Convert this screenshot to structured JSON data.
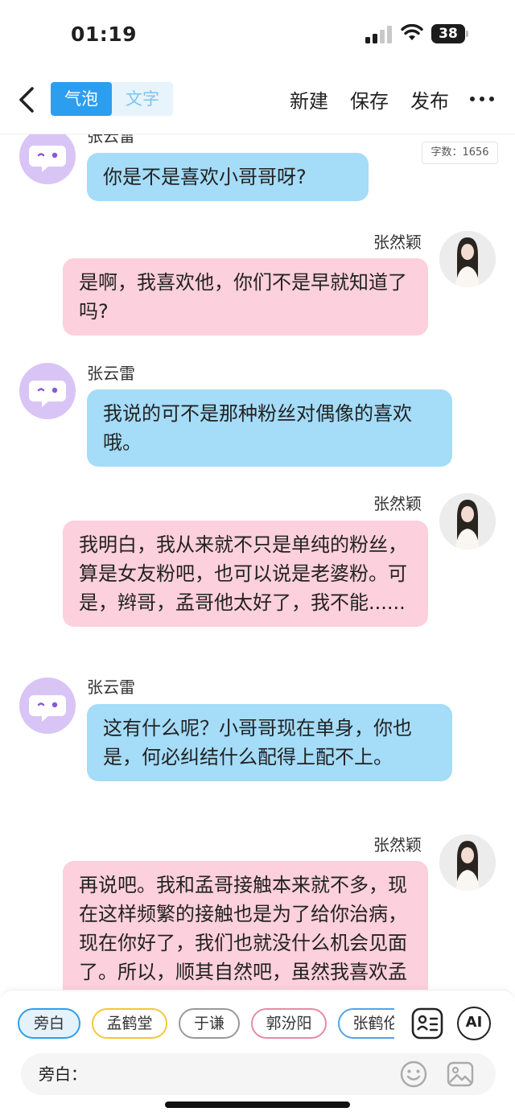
{
  "status_bar": {
    "time": "01:19",
    "battery": "38"
  },
  "topnav": {
    "mode_tabs": [
      "气泡",
      "文字"
    ],
    "active_tab": "气泡",
    "new_label": "新建",
    "save_label": "保存",
    "publish_label": "发布"
  },
  "word_count": "字数：1656",
  "messages": [
    {
      "speaker": "张云雷",
      "side": "left",
      "color": "blue",
      "text": "你是不是喜欢小哥哥呀?"
    },
    {
      "speaker": "张然颖",
      "side": "right",
      "color": "pink",
      "text": "是啊，我喜欢他，你们不是早就知道了吗?"
    },
    {
      "speaker": "张云雷",
      "side": "left",
      "color": "blue",
      "text": "我说的可不是那种粉丝对偶像的喜欢哦。"
    },
    {
      "speaker": "张然颖",
      "side": "right",
      "color": "pink",
      "text": "我明白，我从来就不只是单纯的粉丝，算是女友粉吧，也可以说是老婆粉。可是，辫哥，孟哥他太好了，我不能......"
    },
    {
      "speaker": "张云雷",
      "side": "left",
      "color": "blue",
      "text": "这有什么呢？小哥哥现在单身，你也是，何必纠结什么配得上配不上。"
    },
    {
      "speaker": "张然颖",
      "side": "right",
      "color": "pink",
      "text": "再说吧。我和孟哥接触本来就不多，现在这样频繁的接触也是为了给你治病，现在你好了，我们也就没什么机会见面了。所以，顺其自然吧，虽然我喜欢孟哥，但我并没"
    }
  ],
  "role_chips": [
    "旁白",
    "孟鹤堂",
    "于谦",
    "郭汾阳",
    "张鹤伦"
  ],
  "selected_role": "旁白",
  "input": {
    "label": "旁白："
  },
  "ai_label": "AI",
  "colors": {
    "accent": "#2c9ef0",
    "bubble_blue": "#a5dcf8",
    "bubble_pink": "#fcd0dc",
    "bot_avatar": "#d9c4f6"
  }
}
